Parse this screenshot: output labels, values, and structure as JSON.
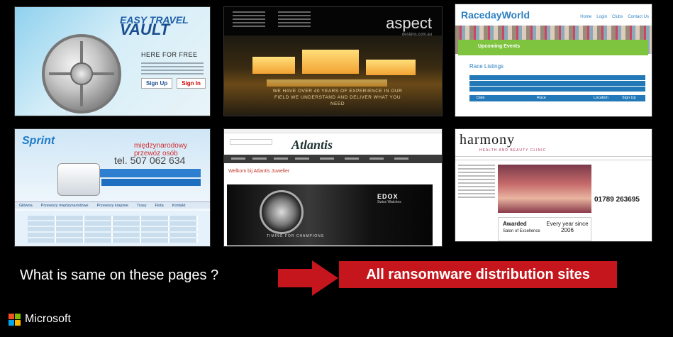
{
  "slide": {
    "question": "What is same on these pages ?",
    "answer": "All ransomware distribution sites",
    "brand": "Microsoft",
    "accent_color": "#c4161c"
  },
  "screenshots": [
    {
      "name": "easy-travel-vault",
      "logo_top": "EASY TRAVEL",
      "logo_bottom": "VAULT",
      "text": "HERE FOR FREE",
      "btn1": "Sign Up",
      "btn2": "Sign In"
    },
    {
      "name": "aspect-designs",
      "logo": "aspect",
      "logo_sub": "designs.com.au",
      "tagline": "WE HAVE OVER 40 YEARS OF EXPERIENCE IN OUR FIELD WE UNDERSTAND AND DELIVER WHAT YOU NEED"
    },
    {
      "name": "raceday-world",
      "logo": "RacedayWorld",
      "nav": [
        "Home",
        "Login",
        "Clubs",
        "Contact Us"
      ],
      "banner": "Upcoming Events",
      "list_title": "Race Listings",
      "cols": [
        "Date",
        "Race",
        "Location",
        "Sign Up"
      ]
    },
    {
      "name": "sprint-bus",
      "logo": "Sprint",
      "tagline": "międzynarodowy przewóz osób",
      "phone": "tel. 507 062 634",
      "nav": [
        "Główna",
        "Przewozy międzynarodowe",
        "Przewozy krajowe",
        "Trasy",
        "Flota",
        "Kontakt"
      ]
    },
    {
      "name": "atlantis-jeweller",
      "logo": "Atlantis",
      "welcome": "Welkom bij Atlantis Juwelier",
      "brand": "EDOX",
      "brand_sub": "Swiss Watches",
      "slogan": "TIMING FOR CHAMPIONS"
    },
    {
      "name": "harmony-clinic",
      "logo": "harmony",
      "sub": "HEALTH AND BEAUTY CLINIC",
      "phone": "01789 263695",
      "award1": "Awarded",
      "award2": "Salon of Excellence",
      "award3": "Every year since 2006"
    }
  ]
}
